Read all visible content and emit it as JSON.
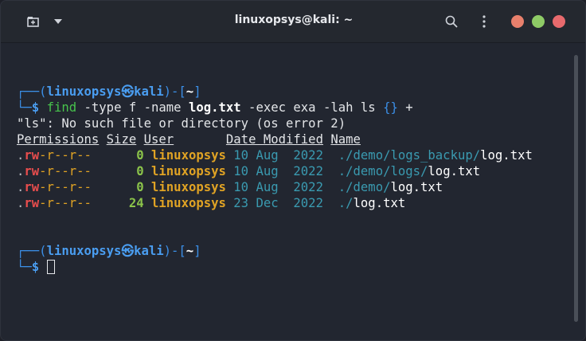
{
  "window": {
    "title": "linuxopsys@kali: ~",
    "icons": [
      "new-tab-icon",
      "chevron-down-icon",
      "search-icon",
      "kebab-menu-icon"
    ],
    "window_controls_colors": [
      "#e8806c",
      "#8ecb66",
      "#e86a6d"
    ]
  },
  "terminal": {
    "prompt1": {
      "top_prefix": "┌──(",
      "user": "linuxopsys",
      "at": "㉿",
      "host": "kali",
      "mid": ")-[",
      "dir": "~",
      "close": "]",
      "bottom_prefix": "└─",
      "dollar": "$",
      "cmd_find": "find",
      "cmd_args1": " -type f -name ",
      "cmd_file": "log.txt",
      "cmd_args2": " -exec exa -lah ls ",
      "cmd_braces": "{}",
      "cmd_plus": " +"
    },
    "error_line": "\"ls\": No such file or directory (os error 2)",
    "headers": {
      "permissions": "Permissions",
      "size": "Size",
      "user": "User",
      "date": "Date Modified",
      "name": "Name"
    },
    "rows": [
      {
        "perm_dot": ".",
        "perm_rw": "rw",
        "perm_rest": "-r--r--",
        "size": "0",
        "user": "linuxopsys",
        "date": "10 Aug  2022",
        "dir": "./demo/logs_backup/",
        "file": "log.txt"
      },
      {
        "perm_dot": ".",
        "perm_rw": "rw",
        "perm_rest": "-r--r--",
        "size": "0",
        "user": "linuxopsys",
        "date": "10 Aug  2022",
        "dir": "./demo/logs/",
        "file": "log.txt"
      },
      {
        "perm_dot": ".",
        "perm_rw": "rw",
        "perm_rest": "-r--r--",
        "size": "0",
        "user": "linuxopsys",
        "date": "10 Aug  2022",
        "dir": "./demo/",
        "file": "log.txt"
      },
      {
        "perm_dot": ".",
        "perm_rw": "rw",
        "perm_rest": "-r--r--",
        "size": "24",
        "user": "linuxopsys",
        "date": "23 Dec  2022",
        "dir": "./",
        "file": "log.txt"
      }
    ],
    "prompt2": {
      "top_prefix": "┌──(",
      "user": "linuxopsys",
      "at": "㉿",
      "host": "kali",
      "mid": ")-[",
      "dir": "~",
      "close": "]",
      "bottom_prefix": "└─",
      "dollar": "$"
    }
  }
}
